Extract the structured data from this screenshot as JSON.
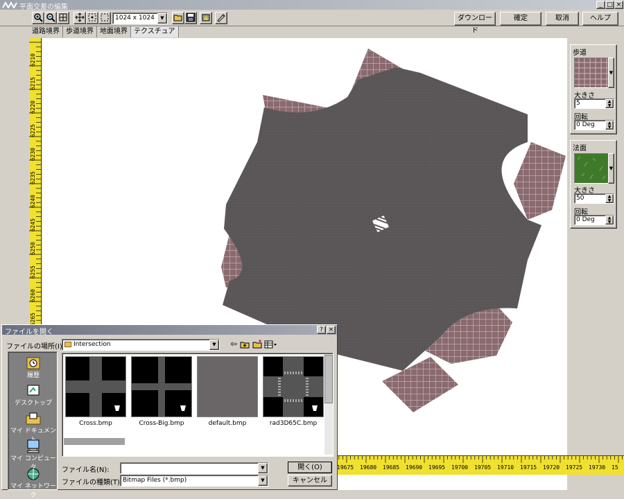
{
  "app": {
    "title": "平面交差の編集",
    "window_buttons": [
      "_",
      "□",
      "×"
    ]
  },
  "toolbar": {
    "zoom_in": "+",
    "zoom_out": "−",
    "fit": "⊞",
    "resolution": "1024 x 1024",
    "download_label": "ダウンロード",
    "confirm_label": "確定",
    "cancel_label": "取消",
    "help_label": "ヘルプ"
  },
  "tabs": [
    "道路境界",
    "歩道境界",
    "地面境界",
    "テクスチュア"
  ],
  "ruler": {
    "vertical": [
      "6210",
      "6215",
      "6220",
      "6225",
      "6230",
      "6235",
      "6240",
      "6245",
      "6250",
      "6255",
      "6260",
      "6265"
    ],
    "horizontal": [
      "19675",
      "19680",
      "19685",
      "19690",
      "19695",
      "19700",
      "19705",
      "19710",
      "19715",
      "19720",
      "19725",
      "19730",
      "15"
    ]
  },
  "panels": {
    "sidewalk": {
      "title": "歩道",
      "size_label": "大きさ",
      "size_value": "5",
      "rotate_label": "回転",
      "rotate_value": "0 Deg"
    },
    "slope": {
      "title": "法面",
      "size_label": "大きさ",
      "size_value": "50",
      "rotate_label": "回転",
      "rotate_value": "0 Deg"
    }
  },
  "dialog": {
    "title": "ファイルを開く",
    "help": "?",
    "close": "×",
    "location_label": "ファイルの場所(I):",
    "location_value": "Intersection",
    "places": [
      "履歴",
      "デスクトップ",
      "マイ ドキュメント",
      "マイ コンピュータ",
      "マイ ネットワーク"
    ],
    "files": [
      "Cross.bmp",
      "Cross-Big.bmp",
      "default.bmp",
      "rad3D65C.bmp"
    ],
    "filename_label": "ファイル名(N):",
    "filename_value": "",
    "filetype_label": "ファイルの種類(T):",
    "filetype_value": "Bitmap Files (*.bmp)",
    "open_label": "開く(O)",
    "cancel_label": "キャンセル"
  },
  "colors": {
    "road": "#5a5658",
    "sidewalk": "#8a6a6e",
    "ruler": "#f0e030",
    "grass": "#3f7a2a"
  }
}
